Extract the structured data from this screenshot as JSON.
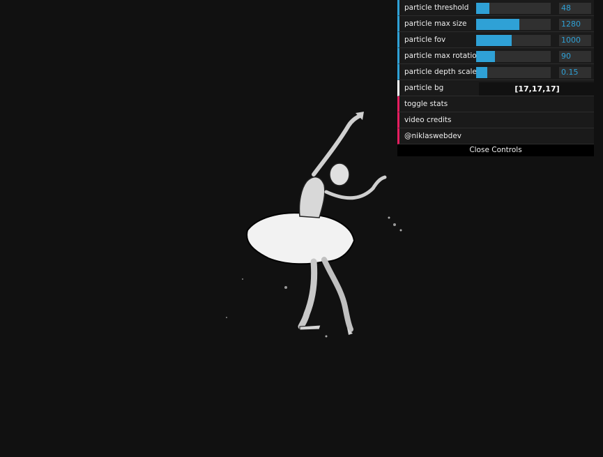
{
  "gui": {
    "sliders": [
      {
        "label": "particle threshold",
        "value": "48",
        "fraction": 0.18
      },
      {
        "label": "particle max size",
        "value": "1280",
        "fraction": 0.58
      },
      {
        "label": "particle fov",
        "value": "1000",
        "fraction": 0.48
      },
      {
        "label": "particle max rotation",
        "value": "90",
        "fraction": 0.25
      },
      {
        "label": "particle depth scale",
        "value": "0.15",
        "fraction": 0.15
      }
    ],
    "color": {
      "label": "particle bg",
      "value": "[17,17,17]"
    },
    "functions": [
      {
        "label": "toggle stats"
      },
      {
        "label": "video credits"
      },
      {
        "label": "@niklaswebdev"
      }
    ],
    "close_label": "Close Controls"
  },
  "colors": {
    "background": "#111111",
    "accent_number": "#2fa1d6",
    "accent_function": "#e61d5f",
    "accent_color": "#ffffff"
  }
}
